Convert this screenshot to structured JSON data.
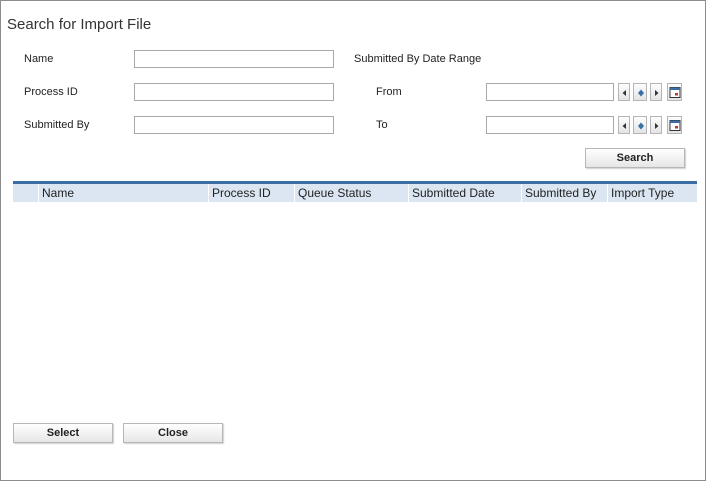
{
  "dialog": {
    "title": "Search for Import File"
  },
  "form": {
    "name_label": "Name",
    "name_value": "",
    "process_id_label": "Process ID",
    "process_id_value": "",
    "submitted_by_label": "Submitted By",
    "submitted_by_value": "",
    "date_range_label": "Submitted By Date Range",
    "from_label": "From",
    "from_value": "",
    "to_label": "To",
    "to_value": "",
    "search_label": "Search"
  },
  "grid": {
    "columns": [
      "",
      "Name",
      "Process ID",
      "Queue Status",
      "Submitted Date",
      "Submitted By",
      "Import Type"
    ],
    "rows": []
  },
  "footer": {
    "select_label": "Select",
    "close_label": "Close"
  },
  "colors": {
    "grid_header_bg": "#dbe6f2",
    "grid_header_rule": "#3a6ea5"
  },
  "icons": {
    "prev": "left-arrow-icon",
    "today": "diamond-icon",
    "next": "right-arrow-icon",
    "calendar": "calendar-icon"
  }
}
